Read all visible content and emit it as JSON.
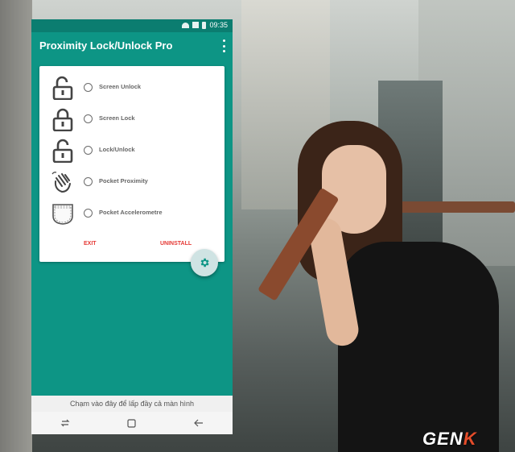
{
  "status_bar": {
    "time": "09:35"
  },
  "app": {
    "title": "Proximity Lock/Unlock Pro"
  },
  "options": [
    {
      "label": "Screen Unlock",
      "icon": "unlocked-padlock-icon"
    },
    {
      "label": "Screen Lock",
      "icon": "locked-padlock-icon"
    },
    {
      "label": "Lock/Unlock",
      "icon": "unlocked-padlock-icon"
    },
    {
      "label": "Pocket Proximity",
      "icon": "hand-wave-icon"
    },
    {
      "label": "Pocket Accelerometre",
      "icon": "pocket-icon"
    }
  ],
  "card_buttons": {
    "exit": "EXIT",
    "uninstall": "UNINSTALL"
  },
  "fab": {
    "icon": "gear-icon"
  },
  "hint": {
    "text": "Chạm vào đây để lấp đầy cả màn hình"
  },
  "navbar": {
    "icons": [
      "recents-icon",
      "home-icon",
      "back-icon"
    ]
  },
  "watermark": {
    "part1": "GEN",
    "part2": "K"
  },
  "colors": {
    "primary": "#0d9585",
    "status": "#0b7d70",
    "accent": "#e53935",
    "fab": "#cfe3e3"
  }
}
